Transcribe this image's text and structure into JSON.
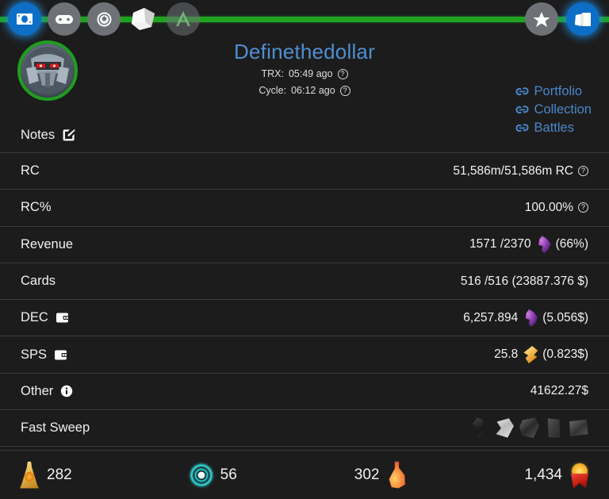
{
  "topbar": {
    "accent_color": "#1fa31f",
    "left_icons": [
      {
        "name": "money-icon",
        "label": "Money"
      },
      {
        "name": "gamepad-icon",
        "label": "Play"
      },
      {
        "name": "soccer-ball-icon",
        "label": "Battle"
      },
      {
        "name": "white-card-icon",
        "label": "Cards"
      },
      {
        "name": "splinter-a-icon",
        "label": "Splinterlands"
      }
    ],
    "right_icons": [
      {
        "name": "star-icon",
        "label": "Favourites"
      },
      {
        "name": "cards-icon",
        "label": "Collection"
      }
    ]
  },
  "header": {
    "username": "Definethedollar",
    "avatar_name": "robot-avatar",
    "avatar_border_color": "#1f9e1f",
    "trx_label": "TRX:",
    "trx_value": "05:49 ago",
    "cycle_label": "Cycle:",
    "cycle_value": "06:12 ago",
    "help_glyph": "?",
    "links": [
      {
        "label": "Portfolio",
        "name": "portfolio-link"
      },
      {
        "label": "Collection",
        "name": "collection-link"
      },
      {
        "label": "Battles",
        "name": "battles-link"
      }
    ],
    "link_color": "#4a86c9",
    "username_color": "#4f8fd1"
  },
  "rows": {
    "notes": {
      "label": "Notes",
      "edit_icon": "pencil-edit-icon"
    },
    "rc": {
      "label": "RC",
      "value": "51,586m/51,586m RC",
      "help": "?"
    },
    "rc_pct": {
      "label": "RC%",
      "value": "100.00%",
      "help": "?"
    },
    "revenue": {
      "label": "Revenue",
      "value": "1571 /2370",
      "token": "dec-token-icon",
      "suffix": "(66%)"
    },
    "cards": {
      "label": "Cards",
      "value": "516 /516 (23887.376 $)"
    },
    "dec": {
      "label": "DEC",
      "wallet_icon": "wallet-icon",
      "value": "6,257.894",
      "token": "dec-token-icon",
      "suffix": "(5.056$)"
    },
    "sps": {
      "label": "SPS",
      "wallet_icon": "wallet-icon",
      "value": "25.8",
      "token": "sps-token-icon",
      "suffix": "(0.823$)"
    },
    "other": {
      "label": "Other",
      "info_icon": "info-icon",
      "value": "41622.27$"
    },
    "fast_sweep": {
      "label": "Fast Sweep",
      "icons": [
        {
          "name": "sweep-dark-shard-icon"
        },
        {
          "name": "sweep-white-card-icon"
        },
        {
          "name": "sweep-grey-gem-icon"
        },
        {
          "name": "sweep-card-pack-icon"
        },
        {
          "name": "sweep-chest-icon"
        }
      ]
    }
  },
  "currency_bar": [
    {
      "name": "merit-currency",
      "icon": "merit-icon",
      "value": "282",
      "icon_side": "left"
    },
    {
      "name": "glint-currency",
      "icon": "glint-icon",
      "value": "56",
      "icon_side": "left"
    },
    {
      "name": "potion-currency",
      "icon": "potion-icon",
      "value": "302",
      "icon_side": "right"
    },
    {
      "name": "ribbon-currency",
      "icon": "ribbon-icon",
      "value": "1,434",
      "icon_side": "right"
    }
  ]
}
